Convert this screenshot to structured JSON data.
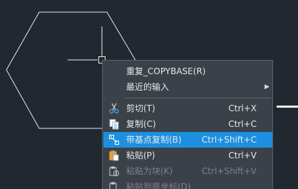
{
  "context_menu": {
    "items": [
      {
        "label": "重复_COPYBASE(R)",
        "shortcut": "",
        "icon": "",
        "submenu": false,
        "disabled": false
      },
      {
        "label": "最近的输入",
        "shortcut": "",
        "icon": "",
        "submenu": true,
        "disabled": false
      },
      {
        "label": "剪切(T)",
        "shortcut": "Ctrl+X",
        "icon": "scissors-icon",
        "submenu": false,
        "disabled": false
      },
      {
        "label": "复制(C)",
        "shortcut": "Ctrl+C",
        "icon": "copy-icon",
        "submenu": false,
        "disabled": false
      },
      {
        "label": "带基点复制(B)",
        "shortcut": "Ctrl+Shift+C",
        "icon": "copy-with-basepoint-icon",
        "submenu": false,
        "disabled": false,
        "highlighted": true
      },
      {
        "label": "粘贴(P)",
        "shortcut": "Ctrl+V",
        "icon": "paste-icon",
        "submenu": false,
        "disabled": false
      },
      {
        "label": "粘贴为块(K)",
        "shortcut": "Ctrl+Shift+V",
        "icon": "paste-as-block-icon",
        "submenu": false,
        "disabled": true
      },
      {
        "label": "粘贴到原坐标(D)",
        "shortcut": "",
        "icon": "paste-to-original-icon",
        "submenu": false,
        "disabled": true
      }
    ],
    "submenu_arrow": "▶"
  },
  "colors": {
    "canvas_background": "#212830",
    "menu_background": "#3b4148",
    "highlight": "#1d8fe0",
    "text": "#e6e8ea",
    "disabled_text": "#7d8288",
    "hexagon_stroke": "#e8e8e8"
  }
}
